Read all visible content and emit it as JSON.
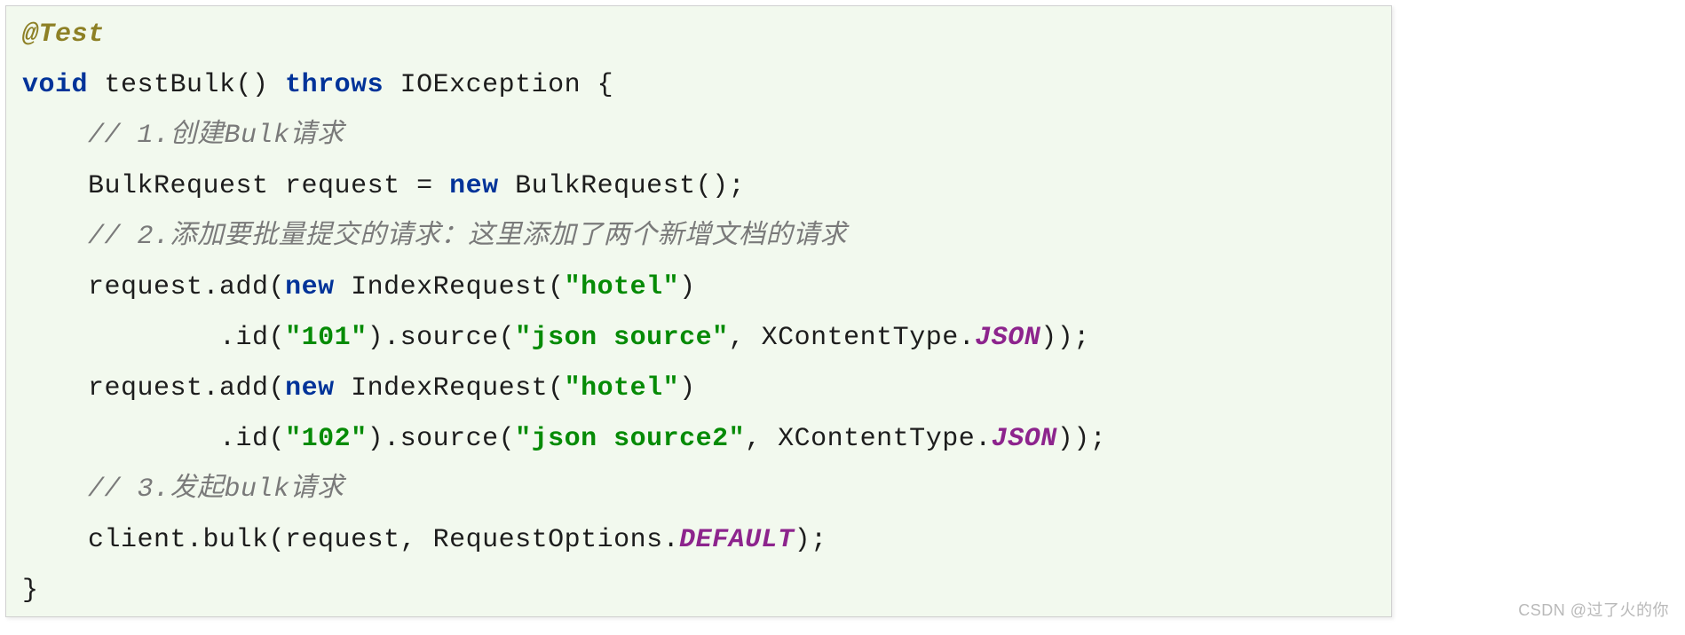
{
  "watermark": "CSDN @过了火的你",
  "code": {
    "annotation": "@Test",
    "kw_void": "void",
    "method_name": " testBulk() ",
    "kw_throws": "throws",
    "throws_type": " IOException {",
    "comment1": "// 1.创建Bulk请求",
    "line_bulk_decl_a": "BulkRequest request = ",
    "kw_new1": "new",
    "line_bulk_decl_b": " BulkRequest();",
    "comment2": "// 2.添加要批量提交的请求：这里添加了两个新增文档的请求",
    "add1_pre": "request.add(",
    "kw_new2": "new",
    "add1_post": " IndexRequest(",
    "str_hotel1": "\"hotel\"",
    "add1_close": ")",
    "add1_id_pre": ".id(",
    "str_101": "\"101\"",
    "add1_id_post": ").source(",
    "str_json1": "\"json source\"",
    "add1_src_post": ", XContentType.",
    "const_json1": "JSON",
    "add1_end": "));",
    "add2_pre": "request.add(",
    "kw_new3": "new",
    "add2_post": " IndexRequest(",
    "str_hotel2": "\"hotel\"",
    "add2_close": ")",
    "add2_id_pre": ".id(",
    "str_102": "\"102\"",
    "add2_id_post": ").source(",
    "str_json2": "\"json source2\"",
    "add2_src_post": ", XContentType.",
    "const_json2": "JSON",
    "add2_end": "));",
    "comment3": "// 3.发起bulk请求",
    "client_line_a": "client.bulk(request, RequestOptions.",
    "const_default": "DEFAULT",
    "client_line_b": ");",
    "brace_close": "}"
  }
}
